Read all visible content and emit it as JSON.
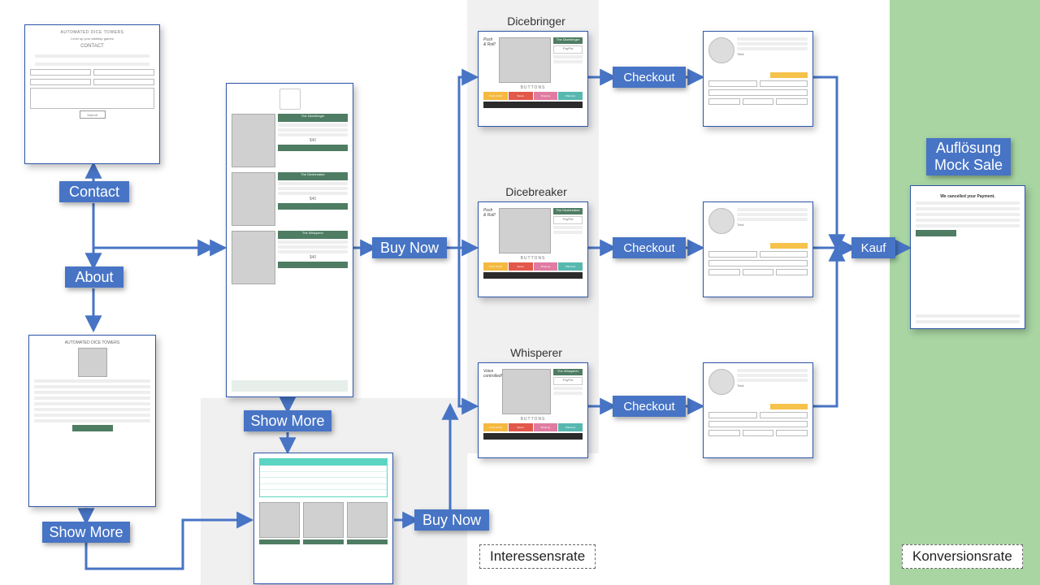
{
  "buttons": {
    "contact": "Contact",
    "about": "About",
    "show_more_left": "Show More",
    "show_more_center": "Show More",
    "buy_now_top": "Buy Now",
    "buy_now_bottom": "Buy Now",
    "checkout_1": "Checkout",
    "checkout_2": "Checkout",
    "checkout_3": "Checkout",
    "kauf": "Kauf",
    "auflosung_l1": "Auflösung",
    "auflosung_l2": "Mock Sale"
  },
  "titles": {
    "dicebringer": "Dicebringer",
    "dicebreaker": "Dicebreaker",
    "whisperer": "Whisperer"
  },
  "zones": {
    "interesse": "Interessensrate",
    "konversion": "Konversionsrate"
  },
  "mock": {
    "contact_header": "AUTOMATED DICE TOWERS",
    "contact_sub": "Level up your tabletop games",
    "contact_title": "CONTACT",
    "submit": "Submit",
    "product1": "The Dicebringer",
    "product2": "The Dicebreaker",
    "product3": "The Whisperer",
    "price": "$40",
    "tabs": {
      "a": "Push & Roll",
      "b": "Specs",
      "c": "Shipping",
      "d": "Warranty"
    },
    "tab_colors": {
      "a": "#f4b93f",
      "b": "#e2584b",
      "c": "#e07ba1",
      "d": "#57b8b0"
    },
    "buttons_word": "BUTTONS",
    "push_roll": "Push & Roll!",
    "voice": "Voice controlled!",
    "cancel_title": "We cancelled your Payment.",
    "paypal": "PayPal",
    "total": "Total"
  }
}
